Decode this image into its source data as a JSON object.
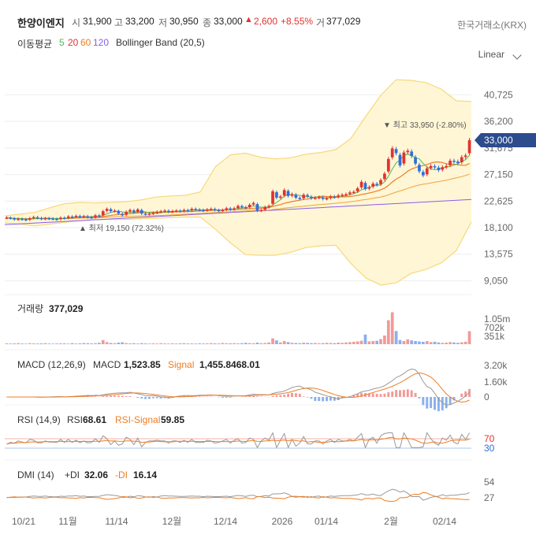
{
  "header": {
    "name": "한양이엔지",
    "open_label": "시",
    "open": "31,900",
    "high_label": "고",
    "high": "33,200",
    "low_label": "저",
    "low": "30,950",
    "close_label": "종",
    "close": "33,000",
    "change_arrow": "▲",
    "change": "2,600",
    "change_pct": "+8.55%",
    "volume_label": "거",
    "volume": "377,029",
    "exchange": "한국거래소(KRX)",
    "ma_label": "이동평균",
    "ma5": "5",
    "ma20": "20",
    "ma60": "60",
    "ma120": "120",
    "bb_label": "Bollinger Band (20,5)",
    "scale": "Linear"
  },
  "colors": {
    "up": "#e4312f",
    "down": "#2f6fdb",
    "ma5": "#59b559",
    "ma20": "#ef7d22",
    "ma60": "#f0a33b",
    "ma120": "#8a5cf0",
    "bb_fill": "#fff6d6",
    "bb_line": "#f7d87a",
    "price_tag": "#2d4c8e"
  },
  "chart_data": [
    {
      "type": "candlestick",
      "title": "price",
      "x_labels": [
        "10/21",
        "11월",
        "11/14",
        "12월",
        "12/14",
        "2026",
        "01/14",
        "2월",
        "02/14"
      ],
      "y_ticks": [
        9050,
        13575,
        18100,
        22625,
        27150,
        31675,
        36200,
        40725
      ],
      "y_tick_labels": [
        "9,050",
        "13,575",
        "18,100",
        "22,625",
        "27,150",
        "31,675",
        "36,200",
        "40,725"
      ],
      "ylim": [
        7500,
        44000
      ],
      "last_price": 33000,
      "last_price_label": "33,000",
      "max_annotation": "최고 33,950 (-2.80%)",
      "min_annotation": "최저 19,150 (72.32%)",
      "close": [
        19800,
        19700,
        19500,
        19600,
        19550,
        19400,
        19700,
        19900,
        19750,
        19600,
        19700,
        19650,
        19600,
        19500,
        19800,
        19700,
        20000,
        19900,
        20100,
        19950,
        20050,
        19900,
        19800,
        20200,
        20100,
        20900,
        21300,
        20900,
        21000,
        20500,
        20200,
        20800,
        21100,
        20700,
        21200,
        20500,
        20400,
        20500,
        20600,
        20800,
        20900,
        21000,
        20800,
        20900,
        21000,
        20900,
        21100,
        21000,
        21300,
        21200,
        21100,
        21000,
        21200,
        21300,
        21100,
        21000,
        21100,
        21400,
        21200,
        21400,
        21800,
        21600,
        21500,
        22000,
        22300,
        21000,
        21100,
        21600,
        21800,
        24300,
        23200,
        23400,
        24500,
        23500,
        23800,
        23200,
        23000,
        23700,
        23400,
        23100,
        23200,
        23300,
        23000,
        23100,
        23400,
        23300,
        23600,
        23700,
        23800,
        24100,
        24200,
        24800,
        25900,
        24700,
        25000,
        25600,
        25400,
        26200,
        27300,
        29800,
        31600,
        30800,
        28700,
        30900,
        31200,
        30300,
        29000,
        27700,
        27000,
        28200,
        28600,
        28400,
        27900,
        28400,
        28600,
        29500,
        29400,
        29100,
        30100,
        30400,
        33000
      ],
      "ma120": [
        18600,
        18700,
        18800,
        18900,
        19000,
        19100,
        19200,
        19300,
        19400,
        19500,
        19600,
        19700,
        19800,
        19900,
        20000,
        20100,
        20200,
        20300,
        20400,
        20500,
        20600,
        20700,
        20800,
        20900,
        21000,
        21100,
        21200,
        21300,
        21400,
        21500,
        21600,
        21700,
        21800,
        21900,
        22000,
        22100,
        22200,
        22300,
        22400,
        22500,
        22600,
        22700,
        22800,
        22900
      ],
      "bb_upper": [
        20100,
        20400,
        20700,
        21500,
        22200,
        22400,
        22300,
        22400,
        22500,
        22800,
        23300,
        23500,
        23600,
        24200,
        28500,
        30500,
        30800,
        30100,
        29800,
        30000,
        30600,
        30900,
        31400,
        33300,
        37100,
        40700,
        43300,
        43200,
        42800,
        41700,
        39700,
        39600
      ],
      "bb_lower": [
        18900,
        18700,
        18400,
        18700,
        19000,
        19300,
        19500,
        19500,
        19500,
        19600,
        19700,
        19800,
        19900,
        19900,
        17800,
        15500,
        13500,
        13400,
        13400,
        13900,
        14700,
        15000,
        15100,
        12000,
        9500,
        8300,
        8700,
        10300,
        11000,
        12100,
        14200,
        19100
      ]
    },
    {
      "type": "bar",
      "title": "거래량",
      "value_label": "377,029",
      "y_tick_labels": [
        "1.05m",
        "702k",
        "351k"
      ],
      "values": [
        25,
        18,
        22,
        30,
        20,
        15,
        28,
        24,
        19,
        22,
        30,
        18,
        16,
        20,
        25,
        22,
        18,
        30,
        20,
        25,
        35,
        28,
        22,
        30,
        40,
        120,
        60,
        35,
        30,
        45,
        55,
        32,
        25,
        28,
        20,
        30,
        22,
        18,
        25,
        20,
        28,
        22,
        18,
        26,
        20,
        25,
        30,
        20,
        22,
        18,
        24,
        20,
        26,
        30,
        22,
        20,
        35,
        28,
        24,
        30,
        26,
        30,
        40,
        32,
        28,
        45,
        30,
        35,
        50,
        170,
        110,
        50,
        90,
        60,
        40,
        35,
        30,
        45,
        38,
        30,
        35,
        28,
        30,
        40,
        35,
        30,
        45,
        40,
        50,
        60,
        70,
        80,
        100,
        280,
        80,
        90,
        100,
        150,
        250,
        690,
        920,
        380,
        120,
        90,
        140,
        110,
        90,
        80,
        70,
        90,
        60,
        70,
        50,
        40,
        45,
        60,
        50,
        40,
        55,
        70,
        377
      ]
    },
    {
      "type": "line",
      "title": "MACD (12,26,9)",
      "series_names": [
        "MACD",
        "Signal"
      ],
      "series_values": [
        "1,523.85",
        "1,455.8468.01"
      ],
      "y_tick_labels": [
        "3.20k",
        "1.60k",
        "0"
      ]
    },
    {
      "type": "line",
      "title": "RSI (14,9)",
      "series_names": [
        "RSI",
        "RSI-Signal"
      ],
      "series_values": [
        "68.61",
        "59.85"
      ],
      "y_tick_labels": [
        "70",
        "30"
      ]
    },
    {
      "type": "line",
      "title": "DMI (14)",
      "series_names": [
        "+DI",
        "-DI"
      ],
      "series_values": [
        "32.06",
        "16.14"
      ],
      "y_tick_labels": [
        "54",
        "27"
      ]
    }
  ]
}
